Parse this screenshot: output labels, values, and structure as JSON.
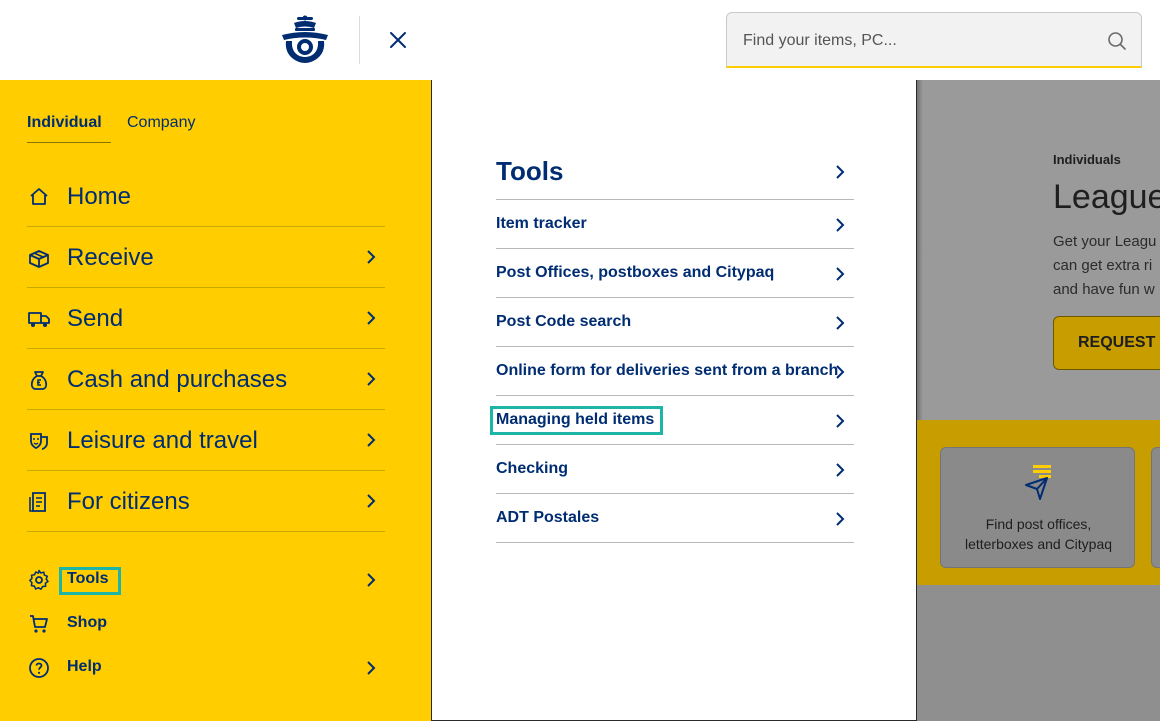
{
  "header": {
    "logo_name": "correos-logo",
    "close_icon": "close-icon",
    "search": {
      "placeholder": "Find your items, PC...",
      "value": "",
      "icon": "search-icon"
    }
  },
  "segment_tabs": [
    {
      "label": "Individual",
      "active": true
    },
    {
      "label": "Company",
      "active": false
    }
  ],
  "main_nav": [
    {
      "label": "Home",
      "icon": "home-icon",
      "has_submenu": false
    },
    {
      "label": "Receive",
      "icon": "package-icon",
      "has_submenu": true
    },
    {
      "label": "Send",
      "icon": "truck-icon",
      "has_submenu": true
    },
    {
      "label": "Cash and purchases",
      "icon": "money-bag-icon",
      "has_submenu": true
    },
    {
      "label": "Leisure and travel",
      "icon": "theater-masks-icon",
      "has_submenu": true
    },
    {
      "label": "For citizens",
      "icon": "document-icon",
      "has_submenu": true
    }
  ],
  "secondary_nav": [
    {
      "label": "Tools",
      "icon": "gear-icon",
      "has_submenu": true,
      "highlighted": true
    },
    {
      "label": "Shop",
      "icon": "cart-icon",
      "has_submenu": false
    },
    {
      "label": "Help",
      "icon": "help-icon",
      "has_submenu": true
    }
  ],
  "submenu": {
    "title": "Tools",
    "items": [
      {
        "label": "Item tracker"
      },
      {
        "label": "Post Offices, postboxes and Citypaq"
      },
      {
        "label": "Post Code search"
      },
      {
        "label": "Online form for deliveries sent from a branch"
      },
      {
        "label": "Managing held items",
        "highlighted": true
      },
      {
        "label": "Checking"
      },
      {
        "label": "ADT Postales"
      }
    ]
  },
  "background_page": {
    "kicker": "Individuals",
    "title": "League",
    "text_lines": [
      "Get your Leagu",
      "can get extra ri",
      "and have fun w"
    ],
    "button_label": "REQUEST Y",
    "card_label_line1": "Find post offices,",
    "card_label_line2": "letterboxes and Citypaq",
    "card_icon": "send-location-icon"
  },
  "colors": {
    "brand_yellow": "#ffcd00",
    "brand_blue": "#002d72",
    "highlight": "#1fb5a6"
  }
}
